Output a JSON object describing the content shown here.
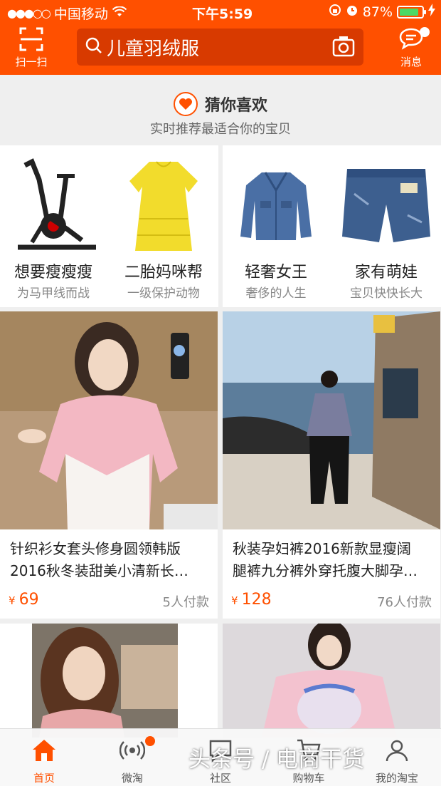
{
  "status_bar": {
    "carrier": "中国移动",
    "time": "下午5:59",
    "battery": "87%",
    "battery_level": 0.87
  },
  "header": {
    "scan_label": "扫一扫",
    "search_query": "儿童羽绒服",
    "message_label": "消息",
    "accent_color": "#ff5000"
  },
  "guess": {
    "title": "猜你喜欢",
    "subtitle": "实时推荐最适合你的宝贝"
  },
  "categories": [
    {
      "title": "想要瘦瘦瘦",
      "subtitle": "为马甲线而战",
      "image": "exercise-bike"
    },
    {
      "title": "二胎妈咪帮",
      "subtitle": "一级保护动物",
      "image": "yellow-dress"
    },
    {
      "title": "轻奢女王",
      "subtitle": "奢侈的人生",
      "image": "denim-jacket"
    },
    {
      "title": "家有萌娃",
      "subtitle": "宝贝快快长大",
      "image": "denim-shorts"
    }
  ],
  "products": [
    {
      "line1": "针织衫女套头修身圆领韩版",
      "line2": "2016秋冬装甜美小清新长…",
      "currency": "¥",
      "price": "69",
      "sold": "5人付款"
    },
    {
      "line1": "秋装孕妇裤2016新款显瘦阔",
      "line2": "腿裤九分裤外穿托腹大脚孕…",
      "currency": "¥",
      "price": "128",
      "sold": "76人付款"
    }
  ],
  "tabs": [
    {
      "label": "首页",
      "icon": "home-icon",
      "active": true
    },
    {
      "label": "微淘",
      "icon": "broadcast-icon"
    },
    {
      "label": "社区",
      "icon": "community-icon"
    },
    {
      "label": "购物车",
      "icon": "cart-icon"
    },
    {
      "label": "我的淘宝",
      "icon": "profile-icon"
    }
  ],
  "watermark": "头条号 / 电商干货"
}
